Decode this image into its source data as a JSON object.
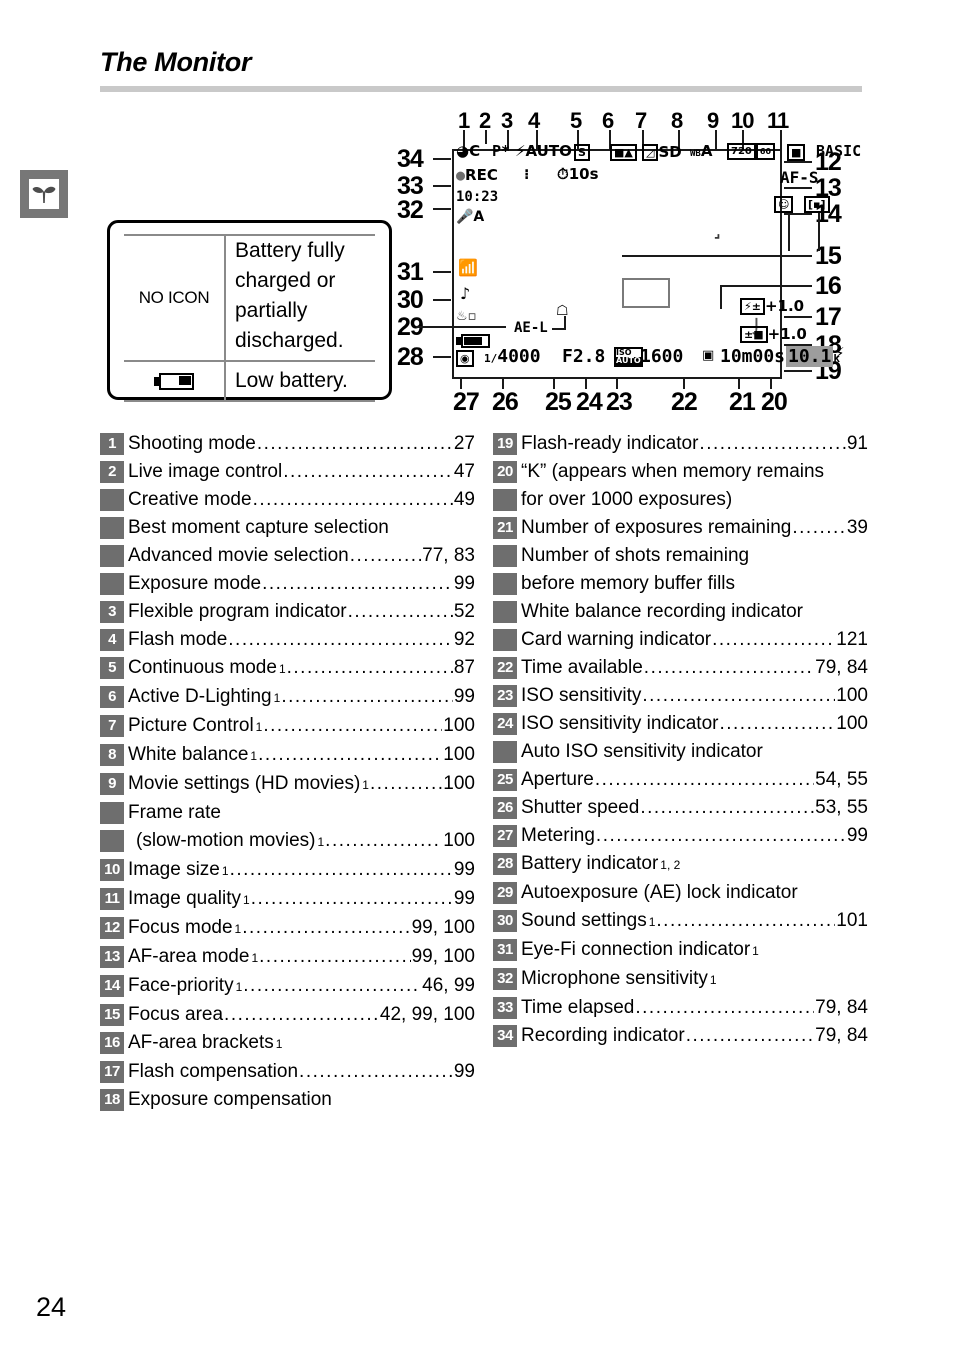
{
  "page": {
    "title": "The Monitor",
    "number": "24",
    "tab_icon": "seedling-icon"
  },
  "battery_legend": {
    "rows": [
      {
        "icon": "NO ICON",
        "icon_kind": "text",
        "desc": "Battery fully charged or partially discharged."
      },
      {
        "icon": "battery-low-icon",
        "icon_kind": "glyph",
        "desc": "Low battery."
      }
    ]
  },
  "diagram": {
    "top_numbers": [
      "1",
      "2",
      "3",
      "4",
      "5",
      "6",
      "7",
      "8",
      "9",
      "10",
      "11"
    ],
    "left_numbers": [
      "34",
      "33",
      "32",
      "31",
      "30",
      "29",
      "28"
    ],
    "right_numbers": [
      "12",
      "13",
      "14",
      "15",
      "16",
      "17",
      "18",
      "19"
    ],
    "bottom_numbers": [
      "27",
      "26",
      "25",
      "24",
      "23",
      "22",
      "21",
      "20"
    ],
    "osd": {
      "row1": [
        "shooting-mode-icon",
        "P*",
        "flash-auto-icon",
        "S",
        "ADL",
        "picture-control-icon",
        "SD",
        "WB-A",
        "720/60",
        "image-size-icon",
        "BASIC"
      ],
      "rec_indicator": "REC",
      "af_brackets": "AF-area-brackets-icon",
      "self_timer": "10s",
      "time_elapsed": "10:23",
      "mic_sensitivity": "mic-A-icon",
      "eye_fi": "eye-fi-icon",
      "sound": "sound-note-icon",
      "ae_lock": "AE-L",
      "battery": "battery-full-icon",
      "af_mode": "AF-S",
      "face_priority": "face-priority-icon",
      "af_area_mode": "af-area-mode-icon",
      "flash_comp": "+1.0",
      "exposure_comp": "+1.0",
      "metering": "metering-icon",
      "shutter_speed": "4000",
      "shutter_prefix": "1/",
      "aperture": "F2.8",
      "iso_label": "ISO",
      "iso_auto": "AUTO",
      "iso_value": "1600",
      "time_available": "10m00s",
      "exposures_remaining": "10.1",
      "k_unit": "k",
      "flash_ready": "flash-ready-icon"
    }
  },
  "index": {
    "left": [
      {
        "num": "1",
        "label": "Shooting mode",
        "sup": "",
        "dots": true,
        "pages": "27"
      },
      {
        "num": "2",
        "label": "Live image control",
        "sup": "",
        "dots": true,
        "pages": "47"
      },
      {
        "num": "",
        "label": "Creative mode ",
        "sup": "",
        "dots": true,
        "pages": "49"
      },
      {
        "num": "",
        "label": "Best moment capture selection",
        "sup": "",
        "dots": false,
        "pages": ""
      },
      {
        "num": "",
        "label": "Advanced movie selection ",
        "sup": "",
        "dots": true,
        "pages": "77, 83"
      },
      {
        "num": "",
        "label": "Exposure mode",
        "sup": "",
        "dots": true,
        "pages": "99"
      },
      {
        "num": "3",
        "label": "Flexible program indicator",
        "sup": "",
        "dots": true,
        "pages": "52"
      },
      {
        "num": "4",
        "label": "Flash mode",
        "sup": "",
        "dots": true,
        "pages": "92"
      },
      {
        "num": "5",
        "label": "Continuous mode",
        "sup": "1",
        "dots": true,
        "pages": "87"
      },
      {
        "num": "6",
        "label": "Active D-Lighting",
        "sup": "1",
        "dots": true,
        "pages": "99"
      },
      {
        "num": "7",
        "label": "Picture Control",
        "sup": "1",
        "dots": true,
        "pages": "100"
      },
      {
        "num": "8",
        "label": "White balance",
        "sup": "1",
        "dots": true,
        "pages": "100"
      },
      {
        "num": "9",
        "label": "Movie settings (HD movies)",
        "sup": "1",
        "dots": true,
        "pages": "100"
      },
      {
        "num": "",
        "label": "Frame rate",
        "sup": "",
        "dots": false,
        "pages": ""
      },
      {
        "num": "",
        "label": " (slow-motion movies)",
        "sup": "1",
        "dots": true,
        "pages": "100",
        "indent": true
      },
      {
        "num": "10",
        "label": "Image size",
        "sup": "1",
        "dots": true,
        "pages": "99"
      },
      {
        "num": "11",
        "label": "Image quality",
        "sup": "1",
        "dots": true,
        "pages": "99"
      },
      {
        "num": "12",
        "label": "Focus mode",
        "sup": "1",
        "dots": true,
        "pages": "99, 100"
      },
      {
        "num": "13",
        "label": "AF-area mode",
        "sup": "1",
        "dots": true,
        "pages": "99, 100"
      },
      {
        "num": "14",
        "label": "Face-priority",
        "sup": "1",
        "dots": true,
        "pages": "46, 99"
      },
      {
        "num": "15",
        "label": "Focus area",
        "sup": "",
        "dots": true,
        "pages": "42, 99, 100"
      },
      {
        "num": "16",
        "label": "AF-area brackets",
        "sup": "1",
        "dots": false,
        "pages": ""
      },
      {
        "num": "17",
        "label": "Flash compensation",
        "sup": "",
        "dots": true,
        "pages": "99"
      },
      {
        "num": "18",
        "label": "Exposure compensation",
        "sup": "",
        "dots": false,
        "pages": ""
      }
    ],
    "right": [
      {
        "num": "19",
        "label": "Flash-ready indicator",
        "sup": "",
        "dots": true,
        "pages": "91"
      },
      {
        "num": "20",
        "label": "“K” (appears when memory remains",
        "sup": "",
        "dots": false,
        "pages": ""
      },
      {
        "num": "",
        "label": " for over 1000 exposures)",
        "sup": "",
        "dots": false,
        "pages": ""
      },
      {
        "num": "21",
        "label": "Number of exposures remaining",
        "sup": "",
        "dots": true,
        "pages": "39"
      },
      {
        "num": "",
        "label": "Number of shots remaining",
        "sup": "",
        "dots": false,
        "pages": ""
      },
      {
        "num": "",
        "label": " before memory buffer fills",
        "sup": "",
        "dots": false,
        "pages": ""
      },
      {
        "num": "",
        "label": "White balance recording indicator",
        "sup": "",
        "dots": false,
        "pages": ""
      },
      {
        "num": "",
        "label": "Card warning indicator",
        "sup": "",
        "dots": true,
        "pages": "121"
      },
      {
        "num": "22",
        "label": "Time available",
        "sup": "",
        "dots": true,
        "pages": "79, 84"
      },
      {
        "num": "23",
        "label": "ISO sensitivity ",
        "sup": "",
        "dots": true,
        "pages": "100"
      },
      {
        "num": "24",
        "label": "ISO sensitivity indicator",
        "sup": "",
        "dots": true,
        "pages": "100"
      },
      {
        "num": "",
        "label": "Auto ISO sensitivity indicator",
        "sup": "",
        "dots": false,
        "pages": ""
      },
      {
        "num": "25",
        "label": "Aperture",
        "sup": "",
        "dots": true,
        "pages": "54, 55"
      },
      {
        "num": "26",
        "label": "Shutter speed ",
        "sup": "",
        "dots": true,
        "pages": "53, 55"
      },
      {
        "num": "27",
        "label": "Metering ",
        "sup": "",
        "dots": true,
        "pages": "99"
      },
      {
        "num": "28",
        "label": "Battery indicator",
        "sup": "1, 2",
        "dots": false,
        "pages": ""
      },
      {
        "num": "29",
        "label": "Autoexposure (AE) lock indicator",
        "sup": "",
        "dots": false,
        "pages": ""
      },
      {
        "num": "30",
        "label": "Sound settings",
        "sup": "1",
        "dots": true,
        "pages": "101"
      },
      {
        "num": "31",
        "label": "Eye-Fi connection indicator",
        "sup": "1",
        "dots": false,
        "pages": ""
      },
      {
        "num": "32",
        "label": "Microphone sensitivity",
        "sup": "1",
        "dots": false,
        "pages": ""
      },
      {
        "num": "33",
        "label": "Time elapsed",
        "sup": "",
        "dots": true,
        "pages": "79, 84"
      },
      {
        "num": "34",
        "label": "Recording indicator",
        "sup": "",
        "dots": true,
        "pages": "79, 84"
      }
    ]
  }
}
